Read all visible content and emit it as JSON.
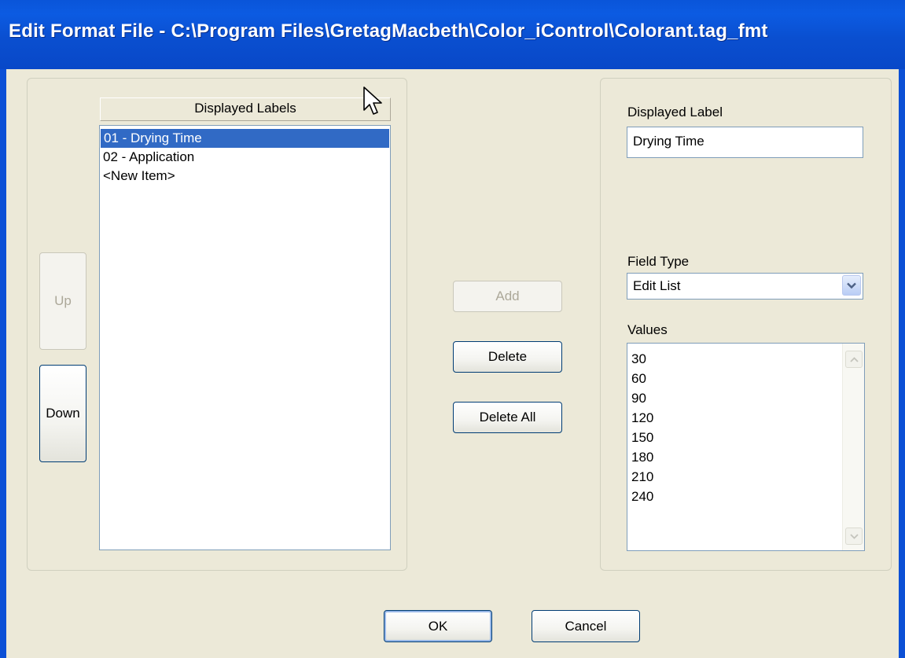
{
  "window": {
    "title": "Edit Format File - C:\\Program Files\\GretagMacbeth\\Color_iControl\\Colorant.tag_fmt"
  },
  "left_panel": {
    "header": "Displayed Labels",
    "items": [
      {
        "label": "01 - Drying Time",
        "selected": true
      },
      {
        "label": "02 - Application",
        "selected": false
      },
      {
        "label": "<New Item>",
        "selected": false
      }
    ],
    "up_label": "Up",
    "down_label": "Down"
  },
  "middle": {
    "add_label": "Add",
    "delete_label": "Delete",
    "delete_all_label": "Delete All"
  },
  "right_panel": {
    "displayed_label_caption": "Displayed Label",
    "displayed_label_value": "Drying Time",
    "field_type_caption": "Field Type",
    "field_type_value": "Edit List",
    "values_caption": "Values",
    "values": [
      "30",
      "60",
      "90",
      "120",
      "150",
      "180",
      "210",
      "240"
    ]
  },
  "footer": {
    "ok_label": "OK",
    "cancel_label": "Cancel"
  },
  "colors": {
    "titlebar": "#0A55D9",
    "dialog_bg": "#ECE9D8",
    "selection": "#316AC5"
  }
}
